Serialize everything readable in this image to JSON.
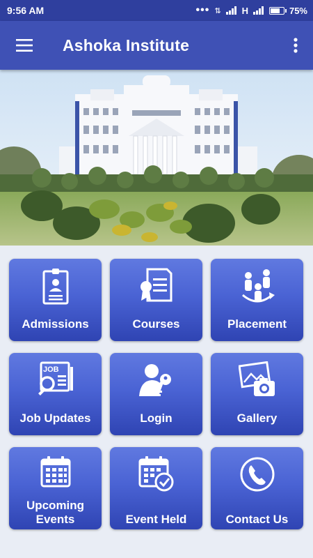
{
  "status_bar": {
    "time": "9:56 AM",
    "network": "H",
    "battery": "75%",
    "battery_level": 0.75
  },
  "app_bar": {
    "title": "Ashoka Institute",
    "menu_icon": "hamburger-menu-icon",
    "overflow_icon": "more-vert-icon"
  },
  "banner": {
    "image": "institute-building-photo"
  },
  "tiles": [
    {
      "label": "Admissions",
      "icon": "id-card-icon"
    },
    {
      "label": "Courses",
      "icon": "document-certificate-icon"
    },
    {
      "label": "Placement",
      "icon": "people-network-icon"
    },
    {
      "label": "Job Updates",
      "icon": "job-search-icon"
    },
    {
      "label": "Login",
      "icon": "user-key-icon"
    },
    {
      "label": "Gallery",
      "icon": "photo-camera-icon"
    },
    {
      "label": "Upcoming Events",
      "icon": "calendar-icon"
    },
    {
      "label": "Event Held",
      "icon": "calendar-check-icon"
    },
    {
      "label": "Contact Us",
      "icon": "phone-icon"
    }
  ],
  "colors": {
    "status_bar": "#2f3f9e",
    "app_bar": "#3f51b5",
    "tile_top": "#6079e0",
    "tile_bottom": "#2f44b3",
    "background": "#e9edf5"
  }
}
